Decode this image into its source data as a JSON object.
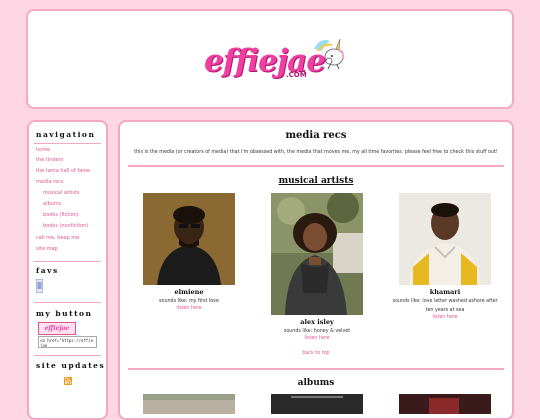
{
  "header": {
    "logo_text": "effiejae",
    "logo_suffix": ".COM"
  },
  "sidebar": {
    "navigation_heading": "navigation",
    "nav_items": [
      {
        "label": "home"
      },
      {
        "label": "the tinders"
      },
      {
        "label": "the tama hall of fame"
      },
      {
        "label": "media recs"
      },
      {
        "label": "musical artists"
      },
      {
        "label": "albums"
      },
      {
        "label": "books (fiction)"
      },
      {
        "label": "books (nonfiction)"
      },
      {
        "label": "call me, beep me"
      },
      {
        "label": "site map"
      }
    ],
    "favs_heading": "favs",
    "button_heading": "my button",
    "button_code": "<a href=\"https://effiejae",
    "updates_heading": "site updates"
  },
  "main": {
    "title": "media recs",
    "intro": "this is the media (or creators of media) that i'm obsessed with, the media that moves me, my all time favorites. please feel free to check this stuff out!",
    "artists_heading": "musical artists",
    "artists": [
      {
        "name": "elmiene",
        "desc": "sounds like: my first love",
        "link": "listen here"
      },
      {
        "name": "alex isley",
        "desc": "sounds like: honey & velvet",
        "link": "listen here"
      },
      {
        "name": "khamari",
        "desc": "sounds like: love letter washed ashore after ten years at sea",
        "link": "listen here"
      }
    ],
    "back_to_top": "back to top",
    "albums_heading": "albums"
  },
  "colors": {
    "accent_pink": "#f5a8c4",
    "link_pink": "#e0558c",
    "background": "#ffd6e4"
  }
}
